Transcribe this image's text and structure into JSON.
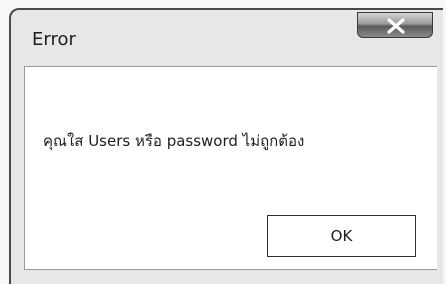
{
  "dialog": {
    "title": "Error",
    "message": "คุณใส Users หรือ password ไม่ถูกต้อง",
    "ok_label": "OK",
    "close_icon": "close-icon"
  },
  "colors": {
    "content_bg": "#ffffff",
    "frame_bg": "#e5e7e8"
  }
}
